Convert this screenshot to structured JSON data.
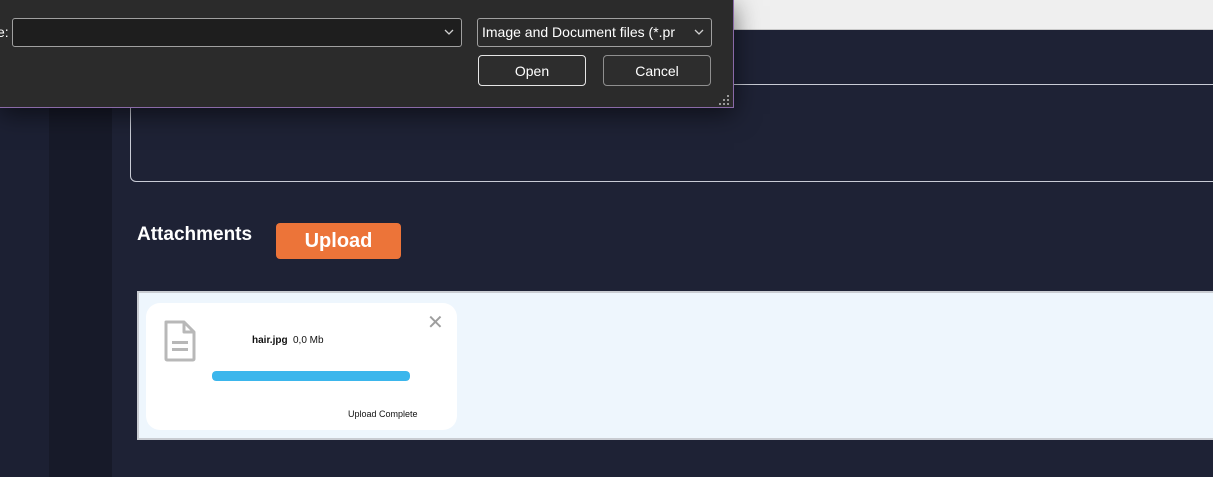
{
  "dialog": {
    "filename_label": "e:",
    "filename_value": "",
    "filetype_selected": "Image and Document files (*.pr",
    "open_label": "Open",
    "cancel_label": "Cancel"
  },
  "attachments": {
    "title": "Attachments",
    "upload_label": "Upload",
    "files": [
      {
        "name": "hair.jpg",
        "size": "0,0 Mb",
        "progress": 1.0,
        "status": "Upload Complete",
        "icon": "document-icon"
      }
    ]
  },
  "colors": {
    "accent": "#ec7439",
    "progress": "#3bb6ec",
    "dialog_bg": "#2b2b2b",
    "page_bg": "#1e2235",
    "dropzone_bg": "#eef6fd"
  }
}
